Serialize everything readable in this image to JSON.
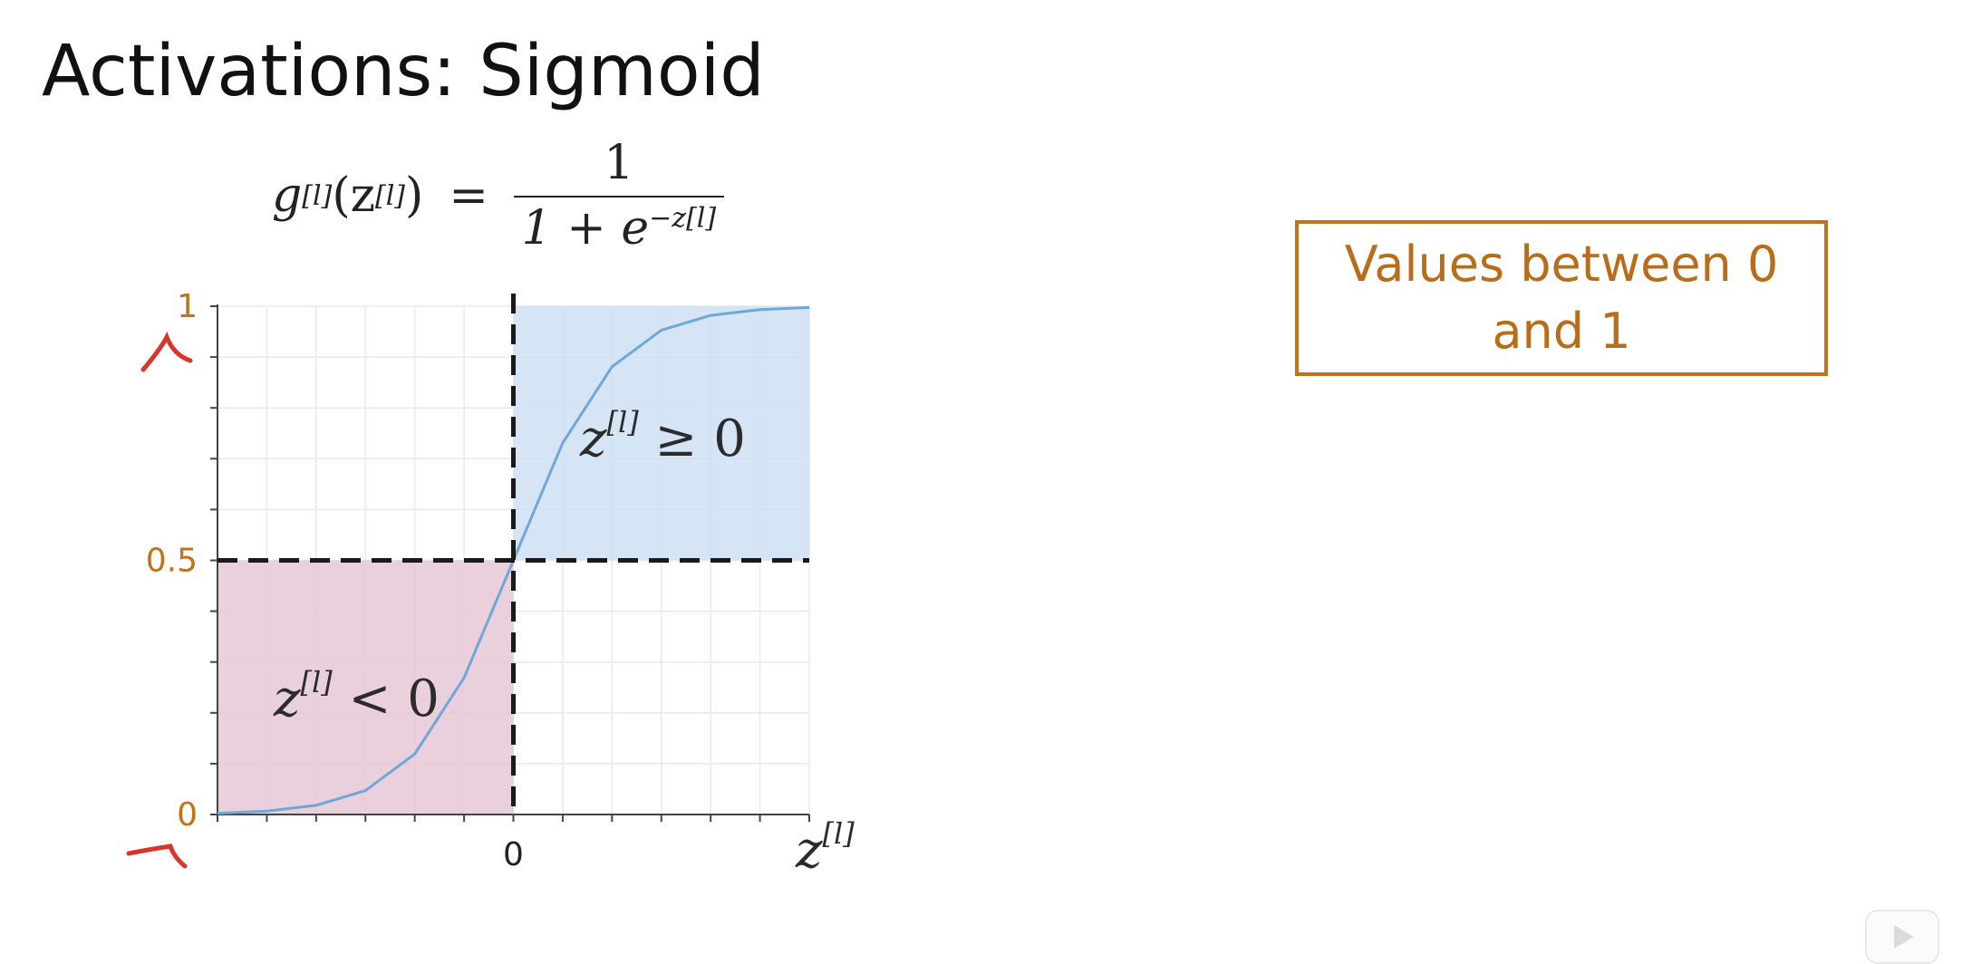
{
  "slide": {
    "title": "Activations: Sigmoid",
    "callout": {
      "line1": "Values between 0",
      "line2": "and 1"
    }
  },
  "formula": {
    "lhs_g": "g",
    "lhs_g_sup": "[l]",
    "lhs_open": "(z",
    "lhs_z_sup": "[l]",
    "lhs_close": ")",
    "equals": "=",
    "numerator": "1",
    "denominator_base": "1 + e",
    "denominator_exp": "−z[l]"
  },
  "colors": {
    "accent_orange": "#c2721a",
    "curve_blue": "#6fa8d8",
    "positive_region": "#cfe0f3",
    "negative_region": "#e6c7d6",
    "guide_dashed": "#1a1a1a",
    "annotation_red": "#d9352b"
  },
  "chart_data": {
    "type": "line",
    "function": "sigmoid",
    "x_domain": [
      -6,
      6
    ],
    "ylim": [
      0,
      1
    ],
    "xlabel": "z[l]",
    "x_tick_labels": [
      "0"
    ],
    "y_tick_labels": [
      "1",
      "0.5",
      "0"
    ],
    "series": [
      {
        "x": [
          -6,
          -5,
          -4,
          -3,
          -2,
          -1,
          0,
          1,
          2,
          3,
          4,
          5,
          6
        ],
        "values": [
          0.0025,
          0.0067,
          0.018,
          0.047,
          0.119,
          0.269,
          0.5,
          0.731,
          0.881,
          0.953,
          0.982,
          0.9933,
          0.9975
        ]
      }
    ],
    "regions": [
      {
        "label": "z[l] < 0",
        "x_range": [
          -6,
          0
        ],
        "y_range": [
          0,
          0.5
        ]
      },
      {
        "label": "z[l] ≥ 0",
        "x_range": [
          0,
          6
        ],
        "y_range": [
          0.5,
          1
        ]
      }
    ],
    "guides": {
      "vertical_at_x": 0,
      "horizontal_at_y": 0.5
    },
    "grid": true
  }
}
